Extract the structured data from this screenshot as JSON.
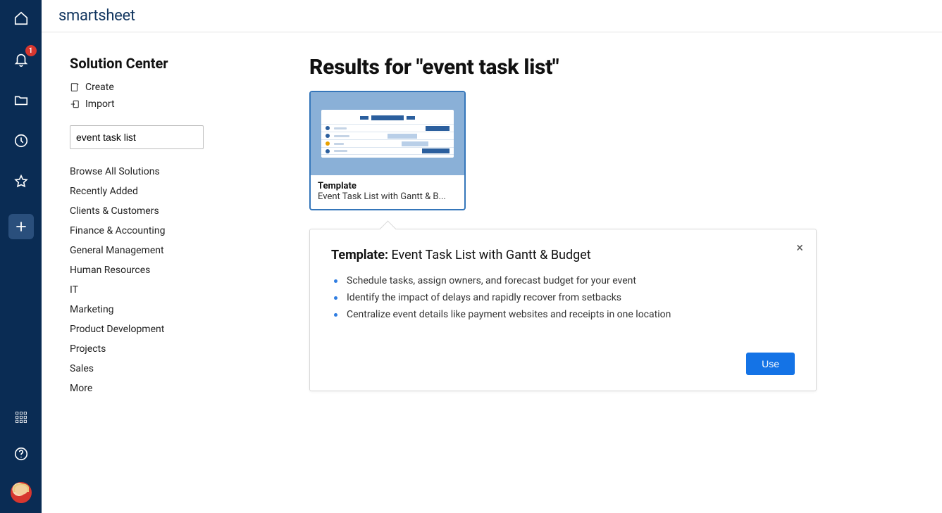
{
  "brand": "smartsheet",
  "rail": {
    "notification_count": "1"
  },
  "sidebar": {
    "title": "Solution Center",
    "actions": {
      "create": "Create",
      "import": "Import"
    },
    "search_value": "event task list",
    "categories": [
      "Browse All Solutions",
      "Recently Added",
      "Clients & Customers",
      "Finance & Accounting",
      "General Management",
      "Human Resources",
      "IT",
      "Marketing",
      "Product Development",
      "Projects",
      "Sales",
      "More"
    ]
  },
  "results": {
    "heading": "Results for \"event task list\"",
    "card": {
      "type_label": "Template",
      "title": "Event Task List with Gantt & B..."
    }
  },
  "detail": {
    "label": "Template:",
    "title": "Event Task List with Gantt & Budget",
    "bullets": [
      "Schedule tasks, assign owners, and forecast budget for your event",
      "Identify the impact of delays and rapidly recover from setbacks",
      "Centralize event details like payment websites and receipts in one location"
    ],
    "use_label": "Use"
  }
}
